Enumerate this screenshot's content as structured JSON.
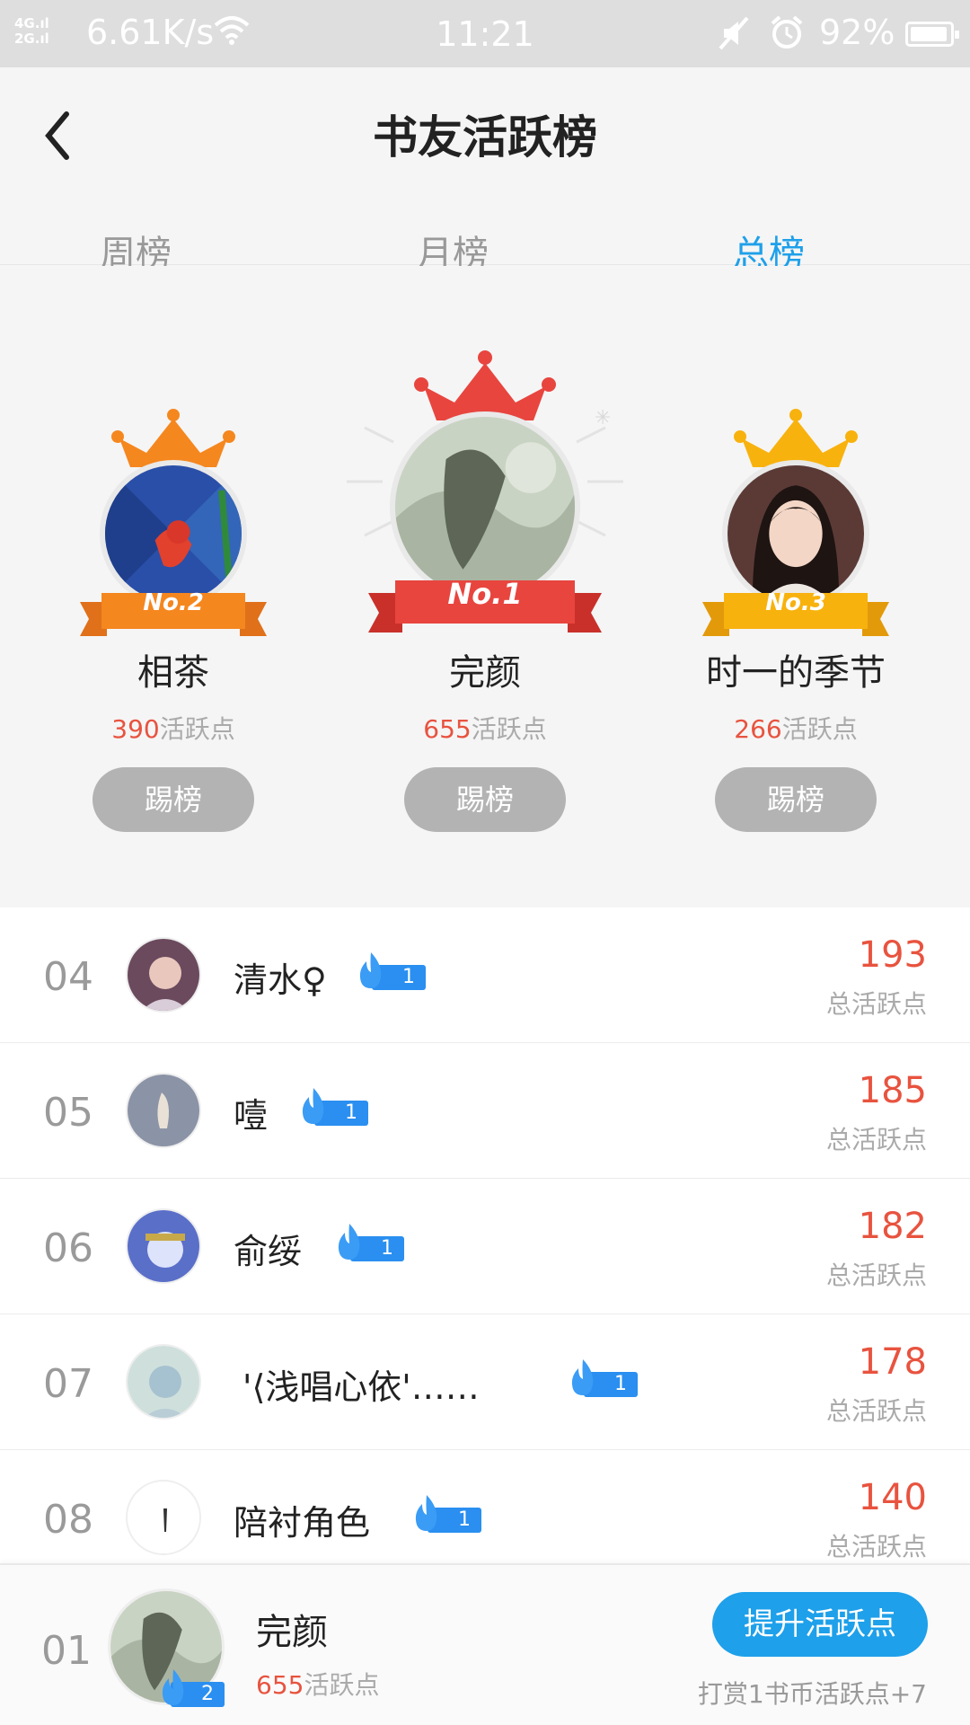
{
  "status_bar": {
    "network": "4G 2G",
    "speed": "6.61K/s",
    "time": "11:21",
    "battery": "92%",
    "battery_level": 0.92
  },
  "header": {
    "title": "书友活跃榜",
    "tabs": [
      {
        "label": "周榜",
        "active": false
      },
      {
        "label": "月榜",
        "active": false
      },
      {
        "label": "总榜",
        "active": true
      }
    ]
  },
  "podium": {
    "first": {
      "rank_label": "No.1",
      "name": "完颜",
      "points": "655",
      "points_suffix": "活跃点",
      "button": "踢榜",
      "color": "#e8453f"
    },
    "second": {
      "rank_label": "No.2",
      "name": "相茶",
      "points": "390",
      "points_suffix": "活跃点",
      "button": "踢榜",
      "color": "#f5871f"
    },
    "third": {
      "rank_label": "No.3",
      "name": "时一的季节",
      "points": "266",
      "points_suffix": "活跃点",
      "button": "踢榜",
      "color": "#f8b20e"
    }
  },
  "list": {
    "points_label": "总活跃点",
    "rows": [
      {
        "rank": "04",
        "name": "清水♀",
        "level": "1",
        "points": "193"
      },
      {
        "rank": "05",
        "name": "噎",
        "level": "1",
        "points": "185"
      },
      {
        "rank": "06",
        "name": "俞绥",
        "level": "1",
        "points": "182"
      },
      {
        "rank": "07",
        "name": "'⟨浅唱心依'……",
        "level": "1",
        "points": "178"
      },
      {
        "rank": "08",
        "name": "陪衬角色",
        "level": "1",
        "points": "140"
      }
    ]
  },
  "me": {
    "rank": "01",
    "name": "完颜",
    "level": "2",
    "points": "655",
    "points_suffix": "活跃点",
    "boost_button": "提升活跃点",
    "hint": "打赏1书币活跃点+7"
  },
  "colors": {
    "accent": "#1ea0ea",
    "points": "#e8533f",
    "button_grey": "#b3b3b3"
  }
}
